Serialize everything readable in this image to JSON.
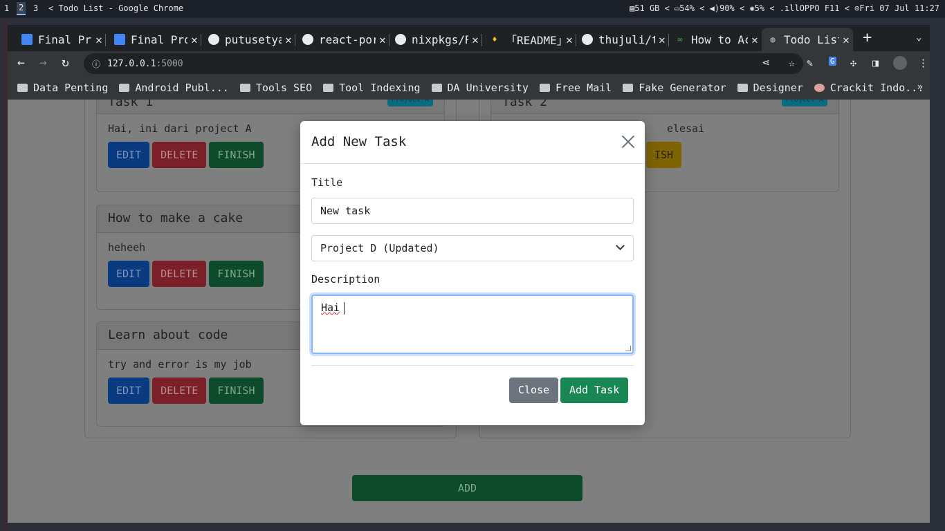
{
  "system": {
    "workspaces": [
      "1",
      "2",
      "3"
    ],
    "window_title": "< Todo List - Google Chrome",
    "status": "▤51 GB  <  ▭54%  <  ◀)90%  <  ✺5%  <  .ıllOPPO F11  <  ⊙Fri 07 Jul 11:27"
  },
  "tabs": [
    {
      "title": "Final Pro",
      "icon": "doc"
    },
    {
      "title": "Final Pro",
      "icon": "doc"
    },
    {
      "title": "putusetya",
      "icon": "github"
    },
    {
      "title": "react-por",
      "icon": "github"
    },
    {
      "title": "nixpkgs/R",
      "icon": "github"
    },
    {
      "title": "「README」",
      "icon": "leaf"
    },
    {
      "title": "thujuli/t",
      "icon": "github"
    },
    {
      "title": "How to Ac",
      "icon": "link"
    },
    {
      "title": "Todo List",
      "icon": "globe"
    }
  ],
  "toolbar": {
    "url_host": "127.0.0.1",
    "url_port": ":5000"
  },
  "bookmarks": [
    "Data Penting",
    "Android Publ...",
    "Tools SEO",
    "Tool Indexing",
    "DA University",
    "Free Mail",
    "Fake Generator",
    "Designer",
    "Crackit Indo..."
  ],
  "page": {
    "cards_left": [
      {
        "title": "Task 1",
        "badge": "Project A",
        "body": "Hai, ini dari project A"
      },
      {
        "title": "How to make a cake",
        "badge": "",
        "body": "heheeh"
      },
      {
        "title": "Learn about code",
        "badge": "",
        "body": "try and error is my job"
      }
    ],
    "card_right": {
      "title": "Task 2",
      "badge": "Project A",
      "body": "elesai",
      "finish_label": "ISH"
    },
    "edit_label": "EDIT",
    "delete_label": "DELETE",
    "finish_label": "FINISH",
    "add_label": "ADD"
  },
  "modal": {
    "title": "Add New Task",
    "title_label": "Title",
    "title_value": "New task",
    "project_value": "Project D (Updated)",
    "description_label": "Description",
    "description_value": "Hai",
    "close_label": "Close",
    "add_label": "Add Task"
  }
}
